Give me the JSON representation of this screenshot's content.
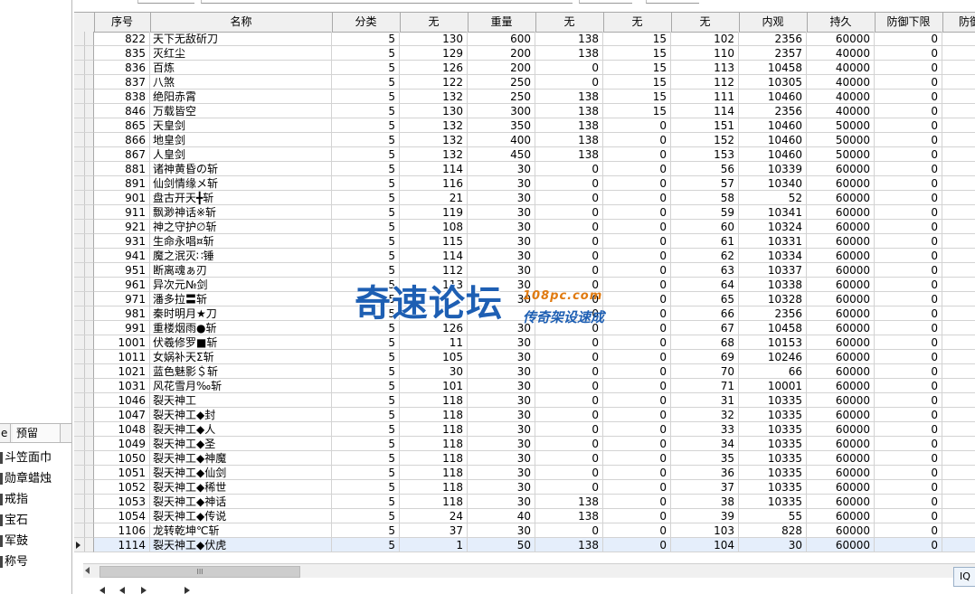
{
  "left_panel": {
    "tabs": [
      "e",
      "预留"
    ],
    "items": [
      "斗笠面巾",
      "勋章蜡烛",
      "戒指",
      "宝石",
      "军鼓",
      "称号"
    ]
  },
  "columns": [
    "序号",
    "名称",
    "分类",
    "无",
    "重量",
    "无",
    "无",
    "无",
    "内观",
    "持久",
    "防御下限",
    "防御"
  ],
  "rows": [
    [
      "822",
      "天下无敌斫刀",
      "5",
      "130",
      "600",
      "138",
      "15",
      "102",
      "2356",
      "60000",
      "0"
    ],
    [
      "835",
      "灭红尘",
      "5",
      "129",
      "200",
      "138",
      "15",
      "110",
      "2357",
      "40000",
      "0"
    ],
    [
      "836",
      "百炼",
      "5",
      "126",
      "200",
      "0",
      "15",
      "113",
      "10458",
      "40000",
      "0"
    ],
    [
      "837",
      "八煞",
      "5",
      "122",
      "250",
      "0",
      "15",
      "112",
      "10305",
      "40000",
      "0"
    ],
    [
      "838",
      "绝阳赤霄",
      "5",
      "132",
      "250",
      "138",
      "15",
      "111",
      "10460",
      "40000",
      "0"
    ],
    [
      "846",
      "万载皆空",
      "5",
      "130",
      "300",
      "138",
      "15",
      "114",
      "2356",
      "40000",
      "0"
    ],
    [
      "865",
      "天皇剑",
      "5",
      "132",
      "350",
      "138",
      "0",
      "151",
      "10460",
      "50000",
      "0"
    ],
    [
      "866",
      "地皇剑",
      "5",
      "132",
      "400",
      "138",
      "0",
      "152",
      "10460",
      "50000",
      "0"
    ],
    [
      "867",
      "人皇剑",
      "5",
      "132",
      "450",
      "138",
      "0",
      "153",
      "10460",
      "50000",
      "0"
    ],
    [
      "881",
      "诸神黄昏の斩",
      "5",
      "114",
      "30",
      "0",
      "0",
      "56",
      "10339",
      "60000",
      "0"
    ],
    [
      "891",
      "仙剑情缘メ斩",
      "5",
      "116",
      "30",
      "0",
      "0",
      "57",
      "10340",
      "60000",
      "0"
    ],
    [
      "901",
      "盘古开天╋斩",
      "5",
      "21",
      "30",
      "0",
      "0",
      "58",
      "52",
      "60000",
      "0"
    ],
    [
      "911",
      "飘渺神话※斩",
      "5",
      "119",
      "30",
      "0",
      "0",
      "59",
      "10341",
      "60000",
      "0"
    ],
    [
      "921",
      "神之守护∅斩",
      "5",
      "108",
      "30",
      "0",
      "0",
      "60",
      "10324",
      "60000",
      "0"
    ],
    [
      "931",
      "生命永唱¤斩",
      "5",
      "115",
      "30",
      "0",
      "0",
      "61",
      "10331",
      "60000",
      "0"
    ],
    [
      "941",
      "魔之泯灭∷锤",
      "5",
      "114",
      "30",
      "0",
      "0",
      "62",
      "10334",
      "60000",
      "0"
    ],
    [
      "951",
      "断离魂ぁ刃",
      "5",
      "112",
      "30",
      "0",
      "0",
      "63",
      "10337",
      "60000",
      "0"
    ],
    [
      "961",
      "异次元№剑",
      "5",
      "113",
      "30",
      "0",
      "0",
      "64",
      "10338",
      "60000",
      "0"
    ],
    [
      "971",
      "潘多拉〓斩",
      "5",
      "",
      "30",
      "0",
      "0",
      "65",
      "10328",
      "60000",
      "0"
    ],
    [
      "981",
      "秦时明月★刀",
      "5",
      "",
      "",
      "0",
      "0",
      "66",
      "2356",
      "60000",
      "0"
    ],
    [
      "991",
      "重楼烟雨●斩",
      "5",
      "126",
      "30",
      "0",
      "0",
      "67",
      "10458",
      "60000",
      "0"
    ],
    [
      "1001",
      "伏羲修罗■斩",
      "5",
      "11",
      "30",
      "0",
      "0",
      "68",
      "10153",
      "60000",
      "0"
    ],
    [
      "1011",
      "女娲补天Σ斩",
      "5",
      "105",
      "30",
      "0",
      "0",
      "69",
      "10246",
      "60000",
      "0"
    ],
    [
      "1021",
      "蓝色魅影＄斩",
      "5",
      "30",
      "30",
      "0",
      "0",
      "70",
      "66",
      "60000",
      "0"
    ],
    [
      "1031",
      "风花雪月‰斩",
      "5",
      "101",
      "30",
      "0",
      "0",
      "71",
      "10001",
      "60000",
      "0"
    ],
    [
      "1046",
      "裂天神工",
      "5",
      "118",
      "30",
      "0",
      "0",
      "31",
      "10335",
      "60000",
      "0"
    ],
    [
      "1047",
      "裂天神工◆封",
      "5",
      "118",
      "30",
      "0",
      "0",
      "32",
      "10335",
      "60000",
      "0"
    ],
    [
      "1048",
      "裂天神工◆人",
      "5",
      "118",
      "30",
      "0",
      "0",
      "33",
      "10335",
      "60000",
      "0"
    ],
    [
      "1049",
      "裂天神工◆圣",
      "5",
      "118",
      "30",
      "0",
      "0",
      "34",
      "10335",
      "60000",
      "0"
    ],
    [
      "1050",
      "裂天神工◆神魔",
      "5",
      "118",
      "30",
      "0",
      "0",
      "35",
      "10335",
      "60000",
      "0"
    ],
    [
      "1051",
      "裂天神工◆仙剑",
      "5",
      "118",
      "30",
      "0",
      "0",
      "36",
      "10335",
      "60000",
      "0"
    ],
    [
      "1052",
      "裂天神工◆稀世",
      "5",
      "118",
      "30",
      "0",
      "0",
      "37",
      "10335",
      "60000",
      "0"
    ],
    [
      "1053",
      "裂天神工◆神话",
      "5",
      "118",
      "30",
      "138",
      "0",
      "38",
      "10335",
      "60000",
      "0"
    ],
    [
      "1054",
      "裂天神工◆传说",
      "5",
      "24",
      "40",
      "138",
      "0",
      "39",
      "55",
      "60000",
      "0"
    ],
    [
      "1106",
      "龙转乾坤℃斩",
      "5",
      "37",
      "30",
      "0",
      "0",
      "103",
      "828",
      "60000",
      "0"
    ],
    [
      "1114",
      "裂天神工◆伏虎",
      "5",
      "1",
      "50",
      "138",
      "0",
      "104",
      "30",
      "60000",
      "0"
    ]
  ],
  "selected_row_index": 35,
  "scrollbar": {
    "thumb_label": "III"
  },
  "watermark": {
    "main": "奇速论坛",
    "url": "108pc.com",
    "sub": "传奇架设速成"
  },
  "corner_button": {
    "label": "IQ"
  }
}
